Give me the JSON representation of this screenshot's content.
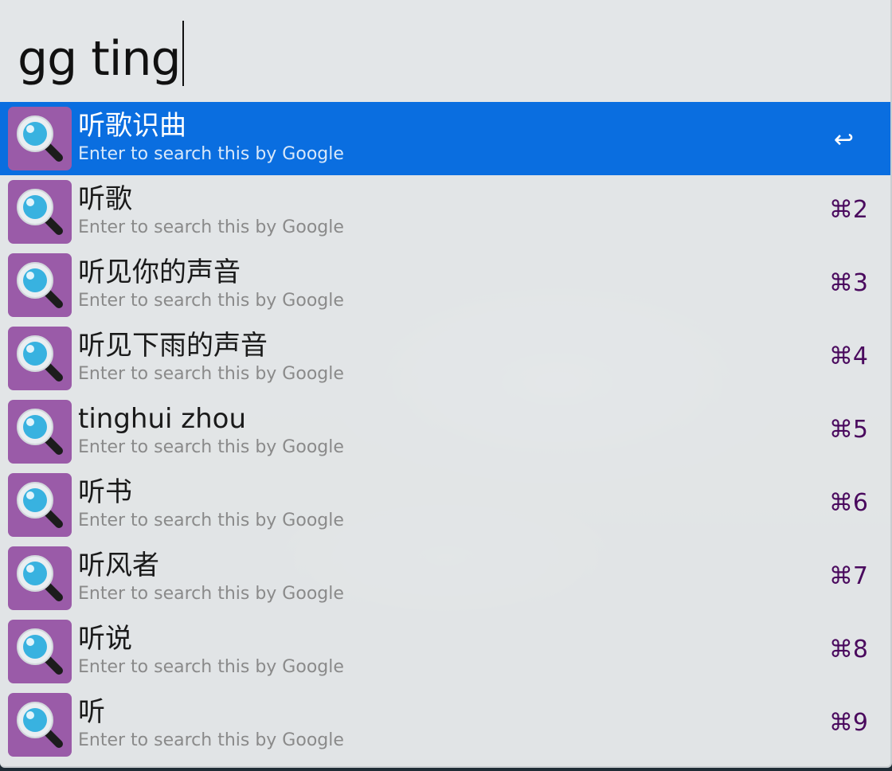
{
  "search": {
    "query": "gg ting"
  },
  "results": [
    {
      "title": "听歌识曲",
      "subtitle": "Enter to search this by Google",
      "shortcut": "↩",
      "selected": true,
      "icon": "magnifier-icon"
    },
    {
      "title": "听歌",
      "subtitle": "Enter to search this by Google",
      "shortcut": "⌘2",
      "selected": false,
      "icon": "magnifier-icon"
    },
    {
      "title": "听见你的声音",
      "subtitle": "Enter to search this by Google",
      "shortcut": "⌘3",
      "selected": false,
      "icon": "magnifier-icon"
    },
    {
      "title": "听见下雨的声音",
      "subtitle": "Enter to search this by Google",
      "shortcut": "⌘4",
      "selected": false,
      "icon": "magnifier-icon"
    },
    {
      "title": "tinghui zhou",
      "subtitle": "Enter to search this by Google",
      "shortcut": "⌘5",
      "selected": false,
      "icon": "magnifier-icon"
    },
    {
      "title": "听书",
      "subtitle": "Enter to search this by Google",
      "shortcut": "⌘6",
      "selected": false,
      "icon": "magnifier-icon"
    },
    {
      "title": "听风者",
      "subtitle": "Enter to search this by Google",
      "shortcut": "⌘7",
      "selected": false,
      "icon": "magnifier-icon"
    },
    {
      "title": "听说",
      "subtitle": "Enter to search this by Google",
      "shortcut": "⌘8",
      "selected": false,
      "icon": "magnifier-icon"
    },
    {
      "title": "听",
      "subtitle": "Enter to search this by Google",
      "shortcut": "⌘9",
      "selected": false,
      "icon": "magnifier-icon"
    }
  ],
  "colors": {
    "selected_background": "#0a6ee0",
    "icon_background": "#9a5ba8",
    "shortcut_text": "#4a0a5e"
  }
}
